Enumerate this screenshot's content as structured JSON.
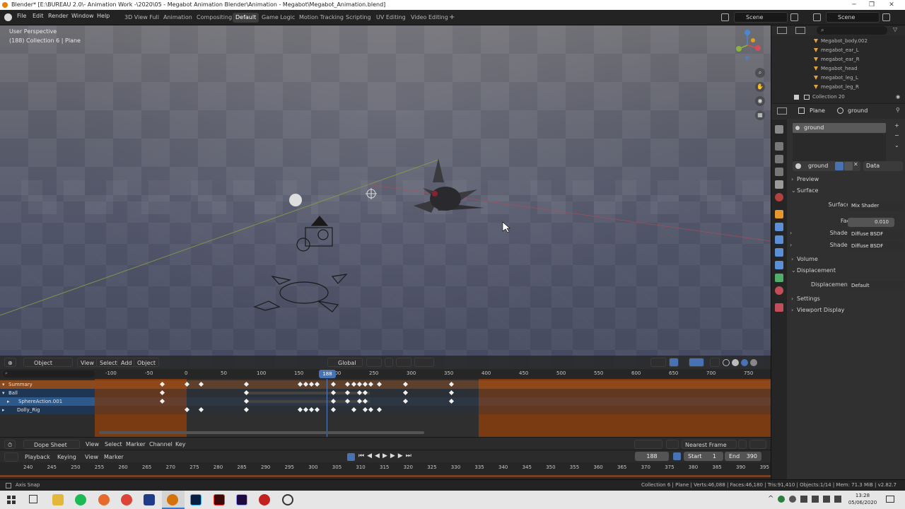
{
  "window": {
    "title": "Blender* [E:\\BUREAU 2.0\\- Animation Work -\\2020\\05 - Megabot Animation Blender\\Animation - Megabot\\Megabot_Animation.blend]",
    "minimize": "─",
    "maximize": "❐",
    "close": "✕"
  },
  "menu": [
    "File",
    "Edit",
    "Render",
    "Window",
    "Help"
  ],
  "workspaces": [
    "3D View Full",
    "Animation",
    "Compositing",
    "Default",
    "Game Logic",
    "Motion Tracking",
    "Scripting",
    "UV Editing",
    "Video Editing"
  ],
  "active_workspace": "Default",
  "add_workspace": "+",
  "scene": "Scene",
  "view_layer": "Scene",
  "viewport": {
    "perspective": "User Perspective",
    "collection": "(188) Collection 6 | Plane",
    "header": {
      "editor": "⊕",
      "mode": "Object Mode",
      "menus": [
        "View",
        "Select",
        "Add",
        "Object"
      ],
      "transform": "Global"
    }
  },
  "outliner": {
    "items": [
      "Megabot_body.002",
      "megabot_ear_L",
      "megabot_ear_R",
      "Megabot_head",
      "megabot_leg_L",
      "megabot_leg_R"
    ],
    "collection": "Collection 20"
  },
  "properties": {
    "object": "Plane",
    "material": "ground",
    "slot": "ground",
    "material_name": "ground",
    "link": "Data",
    "sections": {
      "preview": "Preview",
      "surface": "Surface",
      "volume": "Volume",
      "displacement": "Displacement",
      "settings": "Settings",
      "viewport_display": "Viewport Display"
    },
    "surface_label": "Surface",
    "surface_value": "Mix Shader",
    "fac_label": "Fac",
    "fac_value": "0.010",
    "shader1_label": "Shader",
    "shader1_value": "Diffuse BSDF",
    "shader2_label": "Shader",
    "shader2_value": "Diffuse BSDF",
    "displacement_label": "Displacement",
    "displacement_value": "Default"
  },
  "dopesheet": {
    "ruler": [
      "-100",
      "-50",
      "0",
      "50",
      "100",
      "150",
      "200",
      "250",
      "300",
      "350",
      "400",
      "450",
      "500",
      "550",
      "600",
      "650",
      "700",
      "750"
    ],
    "current_frame": "188",
    "channels": [
      "Summary",
      "Ball",
      "SphereAction.001",
      "Dolly_Rig"
    ],
    "header": {
      "editor": "Dope Sheet",
      "menus": [
        "View",
        "Select",
        "Marker",
        "Channel",
        "Key"
      ],
      "snap": "Nearest Frame"
    }
  },
  "timeline": {
    "menus": [
      "Playback",
      "Keying",
      "View",
      "Marker"
    ],
    "frame": "188",
    "start_label": "Start",
    "start": "1",
    "end_label": "End",
    "end": "390",
    "ruler": [
      "240",
      "245",
      "250",
      "255",
      "260",
      "265",
      "270",
      "275",
      "280",
      "285",
      "290",
      "295",
      "300",
      "305",
      "310",
      "315",
      "320",
      "325",
      "330",
      "335",
      "340",
      "345",
      "350",
      "355",
      "360",
      "365",
      "370",
      "375",
      "380",
      "385",
      "390",
      "395"
    ]
  },
  "status": {
    "left": "Axis Snap",
    "right": "Collection 6 | Plane | Verts:46,088 | Faces:46,180 | Tris:91,410 | Objects:1/14 | Mem: 71.3 MiB | v2.82.7"
  },
  "taskbar": {
    "time": "13:28",
    "date": "05/06/2020"
  },
  "colors": {
    "accent": "#e87d0d",
    "selection": "#4772b3",
    "range_out": "#7a3a12"
  }
}
